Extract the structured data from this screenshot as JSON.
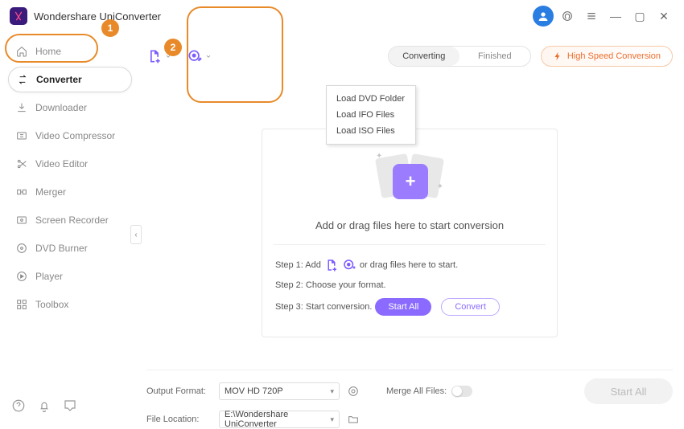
{
  "app": {
    "title": "Wondershare UniConverter"
  },
  "sidebar": {
    "items": [
      {
        "label": "Home"
      },
      {
        "label": "Converter"
      },
      {
        "label": "Downloader"
      },
      {
        "label": "Video Compressor"
      },
      {
        "label": "Video Editor"
      },
      {
        "label": "Merger"
      },
      {
        "label": "Screen Recorder"
      },
      {
        "label": "DVD Burner"
      },
      {
        "label": "Player"
      },
      {
        "label": "Toolbox"
      }
    ],
    "active_index": 1
  },
  "toolbar": {
    "tabs": {
      "converting": "Converting",
      "finished": "Finished",
      "active": "converting"
    },
    "high_speed": "High Speed Conversion",
    "dropdown": {
      "items": [
        "Load DVD Folder",
        "Load IFO Files",
        "Load ISO Files"
      ]
    }
  },
  "dropzone": {
    "title": "Add or drag files here to start conversion",
    "step1_prefix": "Step 1: Add",
    "step1_suffix": "or drag files here to start.",
    "step2": "Step 2: Choose your format.",
    "step3": "Step 3: Start conversion.",
    "start_all": "Start All",
    "convert": "Convert"
  },
  "bottom": {
    "output_format_label": "Output Format:",
    "output_format_value": "MOV HD 720P",
    "file_location_label": "File Location:",
    "file_location_value": "E:\\Wondershare UniConverter",
    "merge_label": "Merge All Files:",
    "start_all": "Start All"
  },
  "annotations": {
    "one": "1",
    "two": "2"
  }
}
